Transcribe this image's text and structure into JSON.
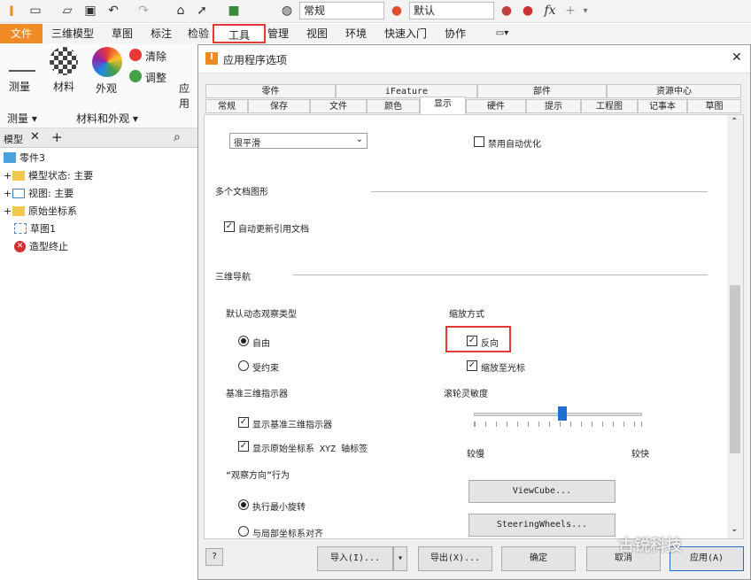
{
  "qat": {
    "style_value": "常规",
    "appearance_value": "默认",
    "fx": "fx"
  },
  "menu": {
    "tabs": [
      "文件",
      "三维模型",
      "草图",
      "标注",
      "检验",
      "工具",
      "管理",
      "视图",
      "环境",
      "快速入门",
      "协作"
    ]
  },
  "ribbon": {
    "measure": "测量",
    "material": "材料",
    "appearance": "外观",
    "clear": "清除",
    "adjust": "调整",
    "app": "应用",
    "group_measure": "测量 ▾",
    "group_material": "材料和外观 ▾"
  },
  "browser": {
    "tab": "模型",
    "items": [
      "零件3",
      "模型状态: 主要",
      "视图: 主要",
      "原始坐标系",
      "草图1",
      "造型终止"
    ]
  },
  "dialog": {
    "title": "应用程序选项",
    "top_tabs": [
      "零件",
      "iFeature",
      "部件",
      "资源中心"
    ],
    "tabs": [
      "常规",
      "保存",
      "文件",
      "颜色",
      "显示",
      "硬件",
      "提示",
      "工程图",
      "记事本",
      "草图"
    ],
    "smooth_value": "很平滑",
    "disable_auto_opt": "禁用自动优化",
    "multi_doc": "多个文档图形",
    "auto_update": "自动更新引用文档",
    "nav3d": "三维导航",
    "default_orbit": "默认动态观察类型",
    "free": "自由",
    "constrained": "受约束",
    "zoom_mode": "缩放方式",
    "reverse": "反向",
    "zoom_cursor": "缩放至光标",
    "wheel_sens": "滚轮灵敏度",
    "slow": "较慢",
    "fast": "较快",
    "slider_level": 0.52,
    "base_indicator": "基准三维指示器",
    "show_base": "显示基准三维指示器",
    "show_origin": "显示原始坐标系 XYZ 轴标签",
    "view_dir": "“观察方向”行为",
    "min_rot": "执行最小旋转",
    "align_local": "与局部坐标系对齐",
    "viewcube": "ViewCube...",
    "steering": "SteeringWheels...",
    "help": "?",
    "import": "导入(I)...",
    "export": "导出(X)...",
    "ok": "确定",
    "cancel": "取消",
    "apply": "应用(A)"
  },
  "watermark": "古锐科技"
}
